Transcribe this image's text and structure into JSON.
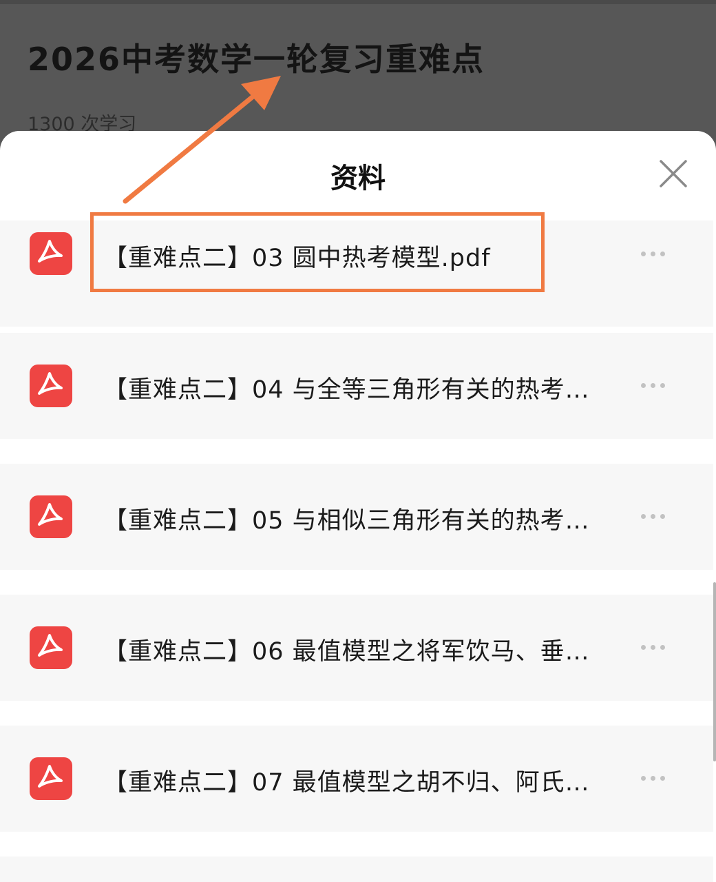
{
  "background": {
    "course_title": "2026中考数学一轮复习重难点",
    "course_meta": "1300 次学习"
  },
  "sheet": {
    "title": "资料",
    "close_icon": "close-icon"
  },
  "files": [
    {
      "name": "【重难点二】03 圆中热考模型.pdf",
      "icon": "pdf-icon"
    },
    {
      "name": "【重难点二】04 与全等三角形有关的热考…",
      "icon": "pdf-icon"
    },
    {
      "name": "【重难点二】05 与相似三角形有关的热考…",
      "icon": "pdf-icon"
    },
    {
      "name": "【重难点二】06 最值模型之将军饮马、垂…",
      "icon": "pdf-icon"
    },
    {
      "name": "【重难点二】07 最值模型之胡不归、阿氏…",
      "icon": "pdf-icon"
    },
    {
      "name": "",
      "icon": ""
    }
  ],
  "colors": {
    "pdf_red": "#ee4543",
    "annotation_orange": "#f07a42",
    "overlay": "#565656",
    "item_bg": "#f7f7f7"
  }
}
